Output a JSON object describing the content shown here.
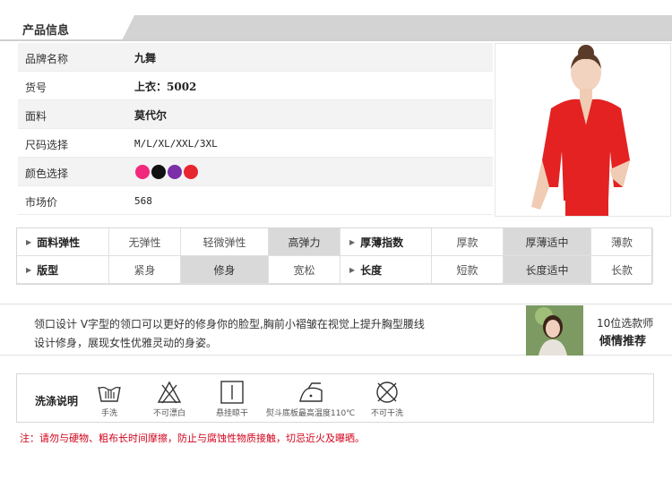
{
  "header": {
    "title": "产品信息"
  },
  "info": {
    "rows": [
      {
        "label": "品牌名称",
        "value": "九舞"
      },
      {
        "label": "货号",
        "value": "上衣：5002"
      },
      {
        "label": "面料",
        "value": "莫代尔"
      },
      {
        "label": "尺码选择",
        "value": "M/L/XL/XXL/3XL"
      },
      {
        "label": "颜色选择",
        "colors": [
          "#f2287d",
          "#111111",
          "#7b2fa8",
          "#e8262f"
        ]
      },
      {
        "label": "市场价",
        "value": "568"
      }
    ]
  },
  "attrs": {
    "row1": {
      "head": "面料弹性",
      "options": [
        "无弹性",
        "轻微弹性",
        "高弹力"
      ],
      "selected": 2,
      "head2": "厚薄指数",
      "options2": [
        "厚款",
        "厚薄适中",
        "薄款"
      ],
      "selected2": 1
    },
    "row2": {
      "head": "版型",
      "options": [
        "紧身",
        "修身",
        "宽松"
      ],
      "selected": 1,
      "head2": "长度",
      "options2": [
        "短款",
        "长度适中",
        "长款"
      ],
      "selected2": 1
    }
  },
  "desc": {
    "line1": "领口设计 V字型的领口可以更好的修身你的脸型,胸前小褶皱在视觉上提升胸型腰线",
    "line2": "设计修身，展现女性优雅灵动的身姿。",
    "rec1": "10位选款师",
    "rec2": "倾情推荐"
  },
  "care": {
    "label": "洗涤说明",
    "items": [
      {
        "icon": "hand-wash-icon",
        "text": "手洗"
      },
      {
        "icon": "no-bleach-icon",
        "text": "不可漂白"
      },
      {
        "icon": "hang-dry-icon",
        "text": "悬挂晾干"
      },
      {
        "icon": "iron-icon",
        "text": "熨斗底板最高温度110℃"
      },
      {
        "icon": "no-dry-clean-icon",
        "text": "不可干洗"
      }
    ]
  },
  "note": "注：请勿与硬物、粗布长时间摩擦，防止与腐蚀性物质接触，切忌近火及曝晒。"
}
